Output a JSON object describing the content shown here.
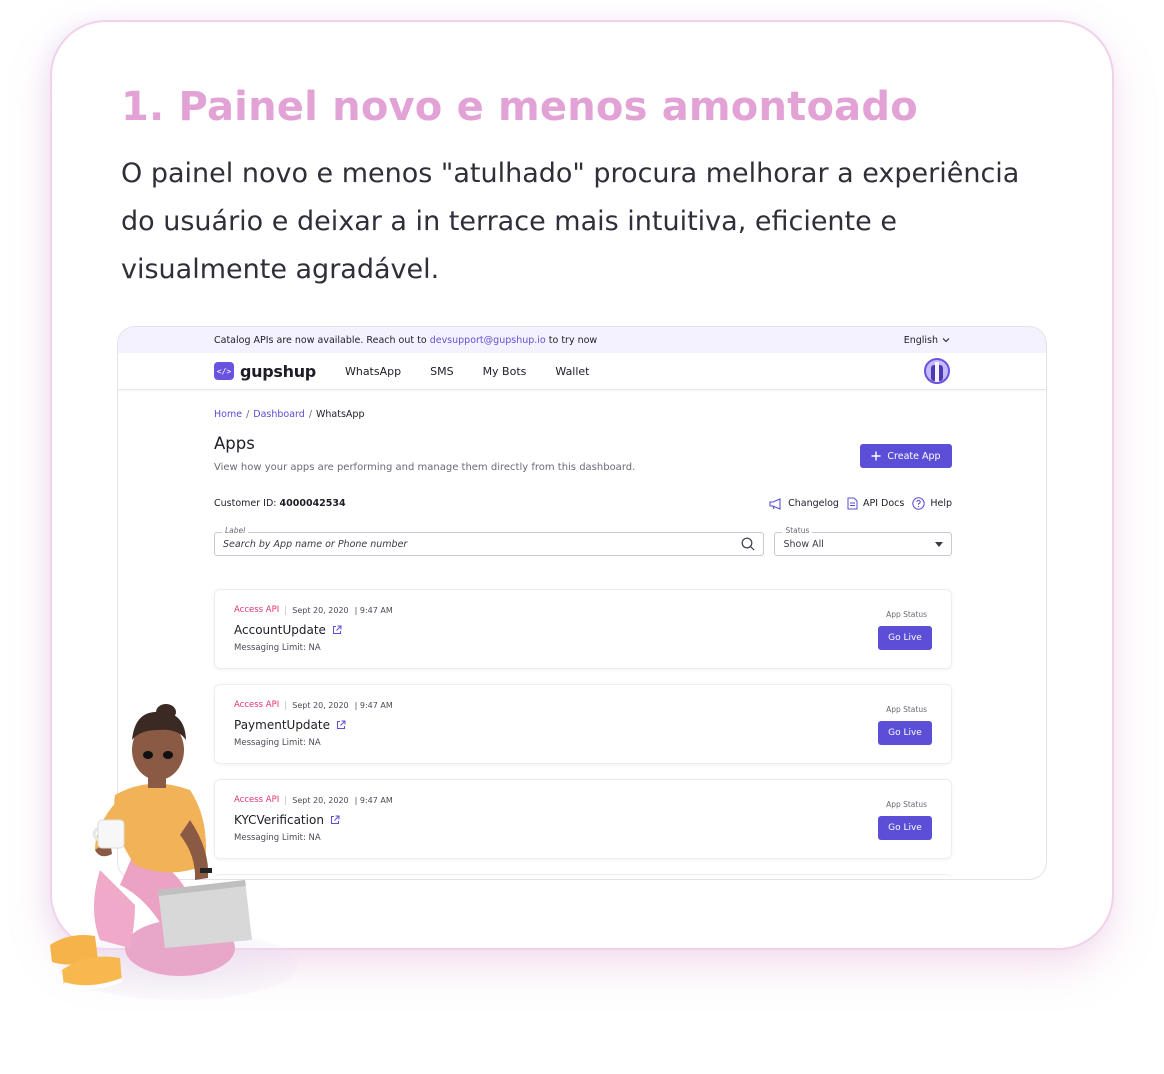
{
  "card": {
    "title": "1. Painel novo e menos amontoado",
    "description": "O painel novo e menos \"atulhado\" procura melhorar a experiência do usuário e deixar a in terrace mais intuitiva, eficiente e visualmente agradável."
  },
  "banner": {
    "text_before": "Catalog APIs are now available. Reach out to",
    "email": "devsupport@gupshup.io",
    "text_after": "to try now",
    "language": "English"
  },
  "nav": {
    "logo": "gupshup",
    "items": [
      "WhatsApp",
      "SMS",
      "My Bots",
      "Wallet"
    ]
  },
  "breadcrumb": {
    "home": "Home",
    "dashboard": "Dashboard",
    "current": "WhatsApp",
    "separator": "/"
  },
  "apps": {
    "title": "Apps",
    "subtitle": "View how your apps are performing and manage them directly from this dashboard.",
    "create_button": "Create App",
    "customer_id_label": "Customer ID:",
    "customer_id": "4000042534",
    "changelog": "Changelog",
    "api_docs": "API Docs",
    "help": "Help"
  },
  "filters": {
    "search_label": "Label",
    "search_placeholder": "Search by App name or Phone number",
    "status_label": "Status",
    "status_value": "Show All"
  },
  "app_list": [
    {
      "type": "Access API",
      "date": "Sept 20, 2020",
      "time": "| 9:47 AM",
      "name": "AccountUpdate",
      "limit": "Messaging Limit: NA",
      "status_label": "App Status",
      "button": "Go Live"
    },
    {
      "type": "Access API",
      "date": "Sept 20, 2020",
      "time": "| 9:47 AM",
      "name": "PaymentUpdate",
      "limit": "Messaging Limit: NA",
      "status_label": "App Status",
      "button": "Go Live"
    },
    {
      "type": "Access API",
      "date": "Sept 20, 2020",
      "time": "| 9:47 AM",
      "name": "KYCVerification",
      "limit": "Messaging Limit: NA",
      "status_label": "App Status",
      "button": "Go Live"
    }
  ],
  "colors": {
    "title_pink": "#e3a2d6",
    "primary": "#5a4fd6",
    "access_api": "#e2336d"
  }
}
